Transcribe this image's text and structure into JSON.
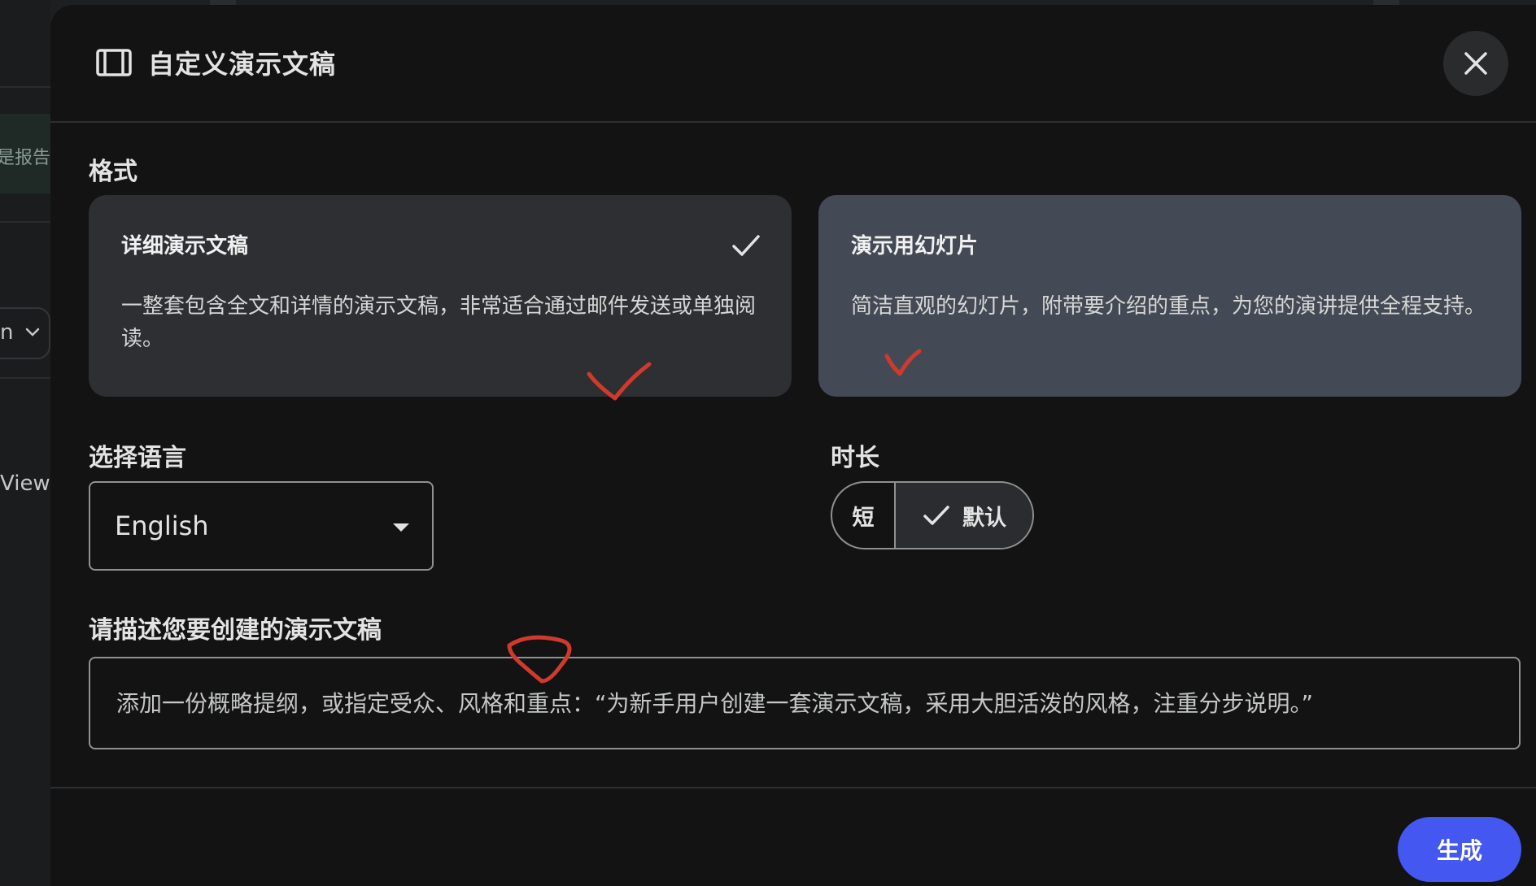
{
  "background": {
    "chip_text": "是报告和",
    "select_text": "n",
    "viewer_text": "Viewer"
  },
  "dialog": {
    "title": "自定义演示文稿",
    "close_icon": "close-icon"
  },
  "format": {
    "label": "格式",
    "cards": [
      {
        "title": "详细演示文稿",
        "description": "一整套包含全文和详情的演示文稿，非常适合通过邮件发送或单独阅读。",
        "selected": true
      },
      {
        "title": "演示用幻灯片",
        "description": "简洁直观的幻灯片，附带要介绍的重点，为您的演讲提供全程支持。",
        "selected": false
      }
    ]
  },
  "language": {
    "label": "选择语言",
    "value": "English"
  },
  "duration": {
    "label": "时长",
    "options": [
      "短",
      "默认"
    ],
    "selected": "默认"
  },
  "description": {
    "label": "请描述您要创建的演示文稿",
    "placeholder": "添加一份概略提纲，或指定受众、风格和重点：“为新手用户创建一套演示文稿，采用大胆活泼的风格，注重分步说明。”"
  },
  "footer": {
    "generate_label": "生成"
  },
  "colors": {
    "accent": "#4457f0",
    "annotation_red": "#d03a2c",
    "card_selected": "#2d2f33",
    "card_other": "#444a55"
  }
}
